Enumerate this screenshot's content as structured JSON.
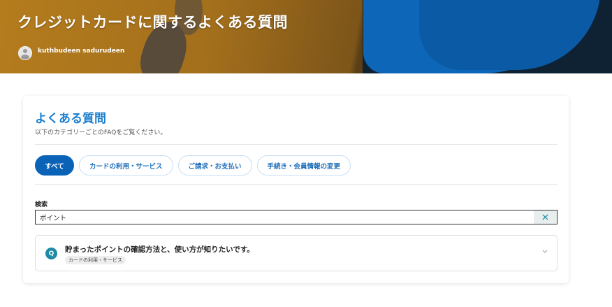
{
  "hero": {
    "title": "クレジットカードに関するよくある質問",
    "author": "kuthbudeen sadurudeen"
  },
  "faq": {
    "heading": "よくある質問",
    "subtitle": "以下のカテゴリーごとのFAQをご覧ください。",
    "tabs": [
      {
        "label": "すべて",
        "active": true
      },
      {
        "label": "カードの利用・サービス",
        "active": false
      },
      {
        "label": "ご請求・お支払い",
        "active": false
      },
      {
        "label": "手続き・会員情報の変更",
        "active": false
      }
    ],
    "search": {
      "label": "検索",
      "value": "ポイント",
      "clear_icon": "close-icon"
    },
    "results": [
      {
        "badge": "Q",
        "question": "貯まったポイントの確認方法と、使い方が知りたいです。",
        "category": "カードの利用・サービス"
      }
    ]
  },
  "colors": {
    "accent": "#0a63b7",
    "heading": "#1b7fcf",
    "badge": "#1f8aa6"
  }
}
